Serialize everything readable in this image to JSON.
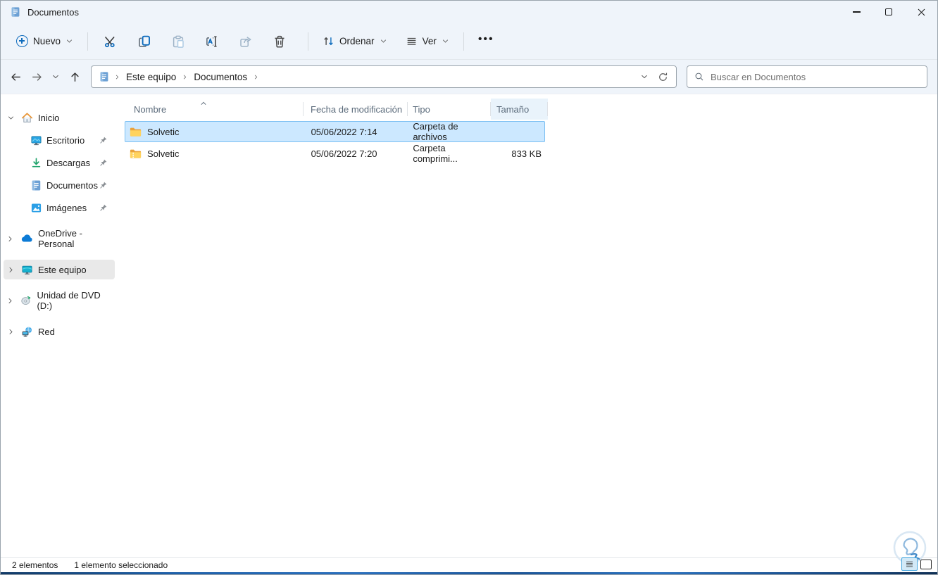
{
  "window": {
    "title": "Documentos"
  },
  "toolbar": {
    "new_label": "Nuevo",
    "sort_label": "Ordenar",
    "view_label": "Ver",
    "more_label": "•••"
  },
  "address": {
    "crumbs": [
      "Este equipo",
      "Documentos"
    ]
  },
  "search": {
    "placeholder": "Buscar en Documentos"
  },
  "sidebar": {
    "items": [
      {
        "label": "Inicio"
      },
      {
        "label": "Escritorio"
      },
      {
        "label": "Descargas"
      },
      {
        "label": "Documentos"
      },
      {
        "label": "Imágenes"
      },
      {
        "label": "OneDrive - Personal"
      },
      {
        "label": "Este equipo"
      },
      {
        "label": "Unidad de DVD (D:)"
      },
      {
        "label": "Red"
      }
    ]
  },
  "list": {
    "columns": [
      "Nombre",
      "Fecha de modificación",
      "Tipo",
      "Tamaño"
    ],
    "rows": [
      {
        "name": "Solvetic",
        "date": "05/06/2022 7:14",
        "type": "Carpeta de archivos",
        "size": ""
      },
      {
        "name": "Solvetic",
        "date": "05/06/2022 7:20",
        "type": "Carpeta comprimi...",
        "size": "833 KB"
      }
    ]
  },
  "statusbar": {
    "items_count": "2 elementos",
    "selection_count": "1 elemento seleccionado"
  },
  "colors": {
    "accent": "#0f6cbd",
    "chrome_bg": "#eff4fa",
    "selection_fill": "#cce8ff",
    "selection_border": "#7cc0f2",
    "sidebar_selected": "#e9e9e9",
    "folder_yellow": "#ffd35e",
    "bottom_strip_blue": "#1d5fa8"
  }
}
